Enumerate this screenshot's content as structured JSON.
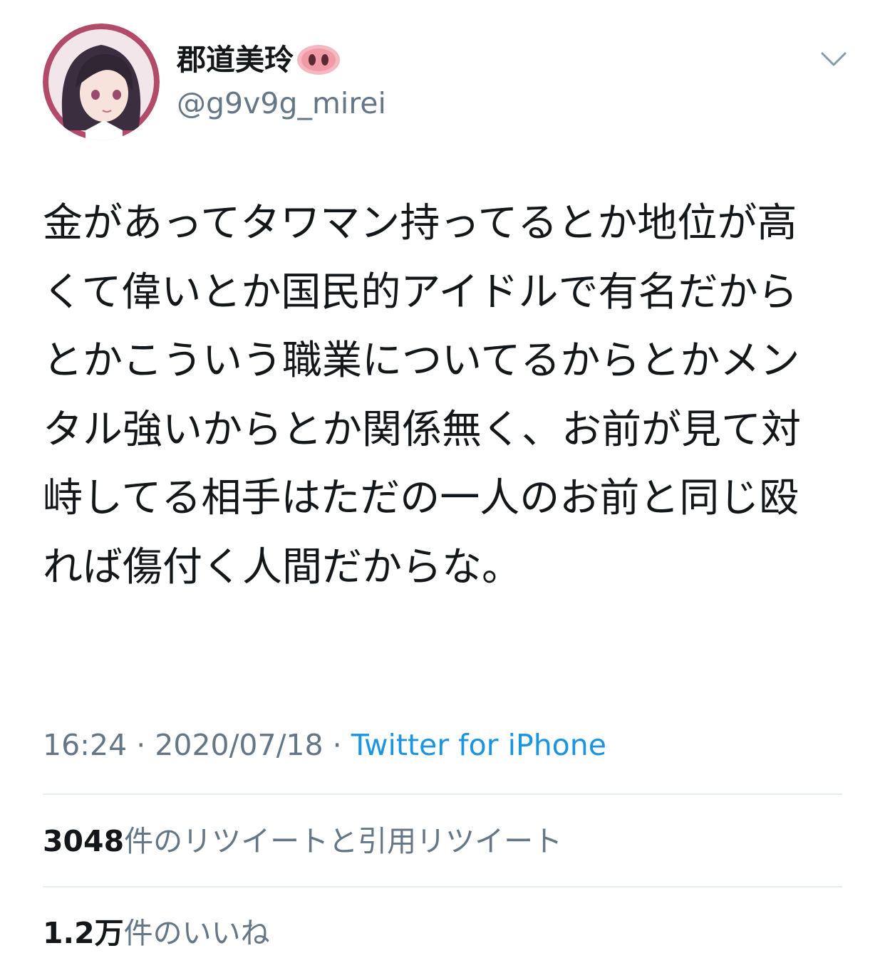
{
  "user": {
    "display_name": "郡道美玲",
    "handle": "@g9v9g_mirei",
    "name_emoji": "pig-nose-icon"
  },
  "tweet": {
    "text": "金があってタワマン持ってるとか地位が高くて偉いとか国民的アイドルで有名だからとかこういう職業についてるからとかメンタル強いからとか関係無く、お前が見て対峙してる相手はただの一人のお前と同じ殴れば傷付く人間だからな。",
    "time": "16:24",
    "separator": "·",
    "date": "2020/07/18",
    "source": "Twitter for iPhone"
  },
  "stats": {
    "retweets_count": "3048",
    "retweets_label": "件のリツイートと引用リツイート",
    "likes_count": "1.2万",
    "likes_label": "件のいいね"
  },
  "icons": {
    "menu": "chevron-down-icon",
    "avatar": "avatar-image"
  },
  "colors": {
    "text_primary": "#14171a",
    "text_secondary": "#657786",
    "link": "#1b95e0",
    "divider": "#e6ecf0",
    "avatar_ring": "#b24a6a"
  }
}
